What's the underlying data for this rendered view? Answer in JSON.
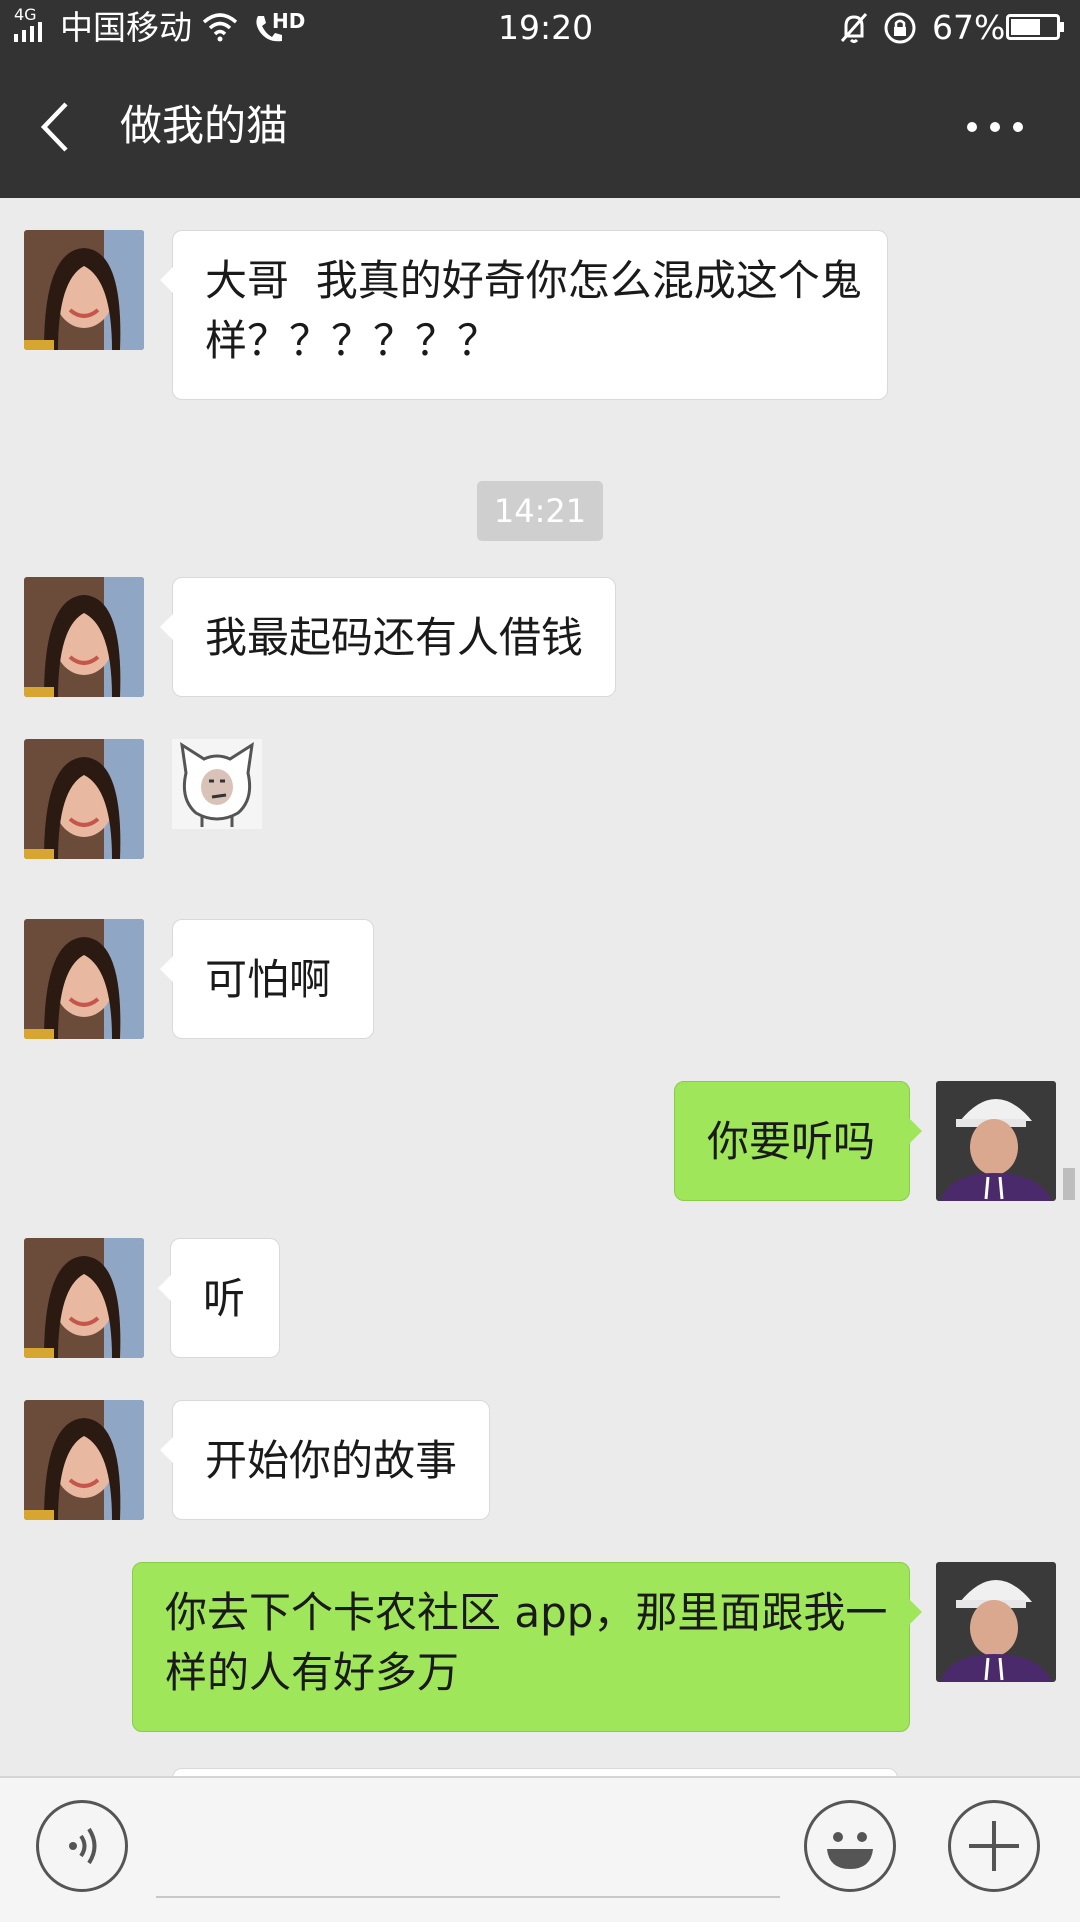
{
  "status_bar": {
    "network": "4G",
    "carrier": "中国移动",
    "hd": "HD",
    "time": "19:20",
    "battery_percent": "67%",
    "battery_level": 0.67
  },
  "header": {
    "title": "做我的猫"
  },
  "chat": {
    "messages": [
      {
        "from": "contact",
        "text": "大哥  我真的好奇你怎么混成这个鬼样？？？？？？",
        "lines": [
          "大哥  我真的好奇你怎么混成这个鬼",
          "样？？？？？？"
        ]
      },
      {
        "timestamp": "14:21"
      },
      {
        "from": "contact",
        "text": "我最起码还有人借钱"
      },
      {
        "from": "contact",
        "sticker": "cat-face-sticker"
      },
      {
        "from": "contact",
        "text": "可怕啊"
      },
      {
        "from": "me",
        "text": "你要听吗"
      },
      {
        "from": "contact",
        "text": "听"
      },
      {
        "from": "contact",
        "text": "开始你的故事"
      },
      {
        "from": "me",
        "text": "你去下个卡农社区 app，那里面跟我一样的人有好多万",
        "lines": [
          "你去下个卡农社区 app，那里面跟我一",
          "样的人有好多万"
        ]
      }
    ]
  },
  "icons": {
    "back": "back-arrow-icon",
    "more": "more-options-icon",
    "voice": "voice-input-icon",
    "emoji": "emoji-icon",
    "plus": "plus-icon"
  },
  "colors": {
    "bar": "#333333",
    "chat_bg": "#ebebeb",
    "outgoing_bubble": "#9fe65a",
    "incoming_bubble": "#ffffff"
  }
}
